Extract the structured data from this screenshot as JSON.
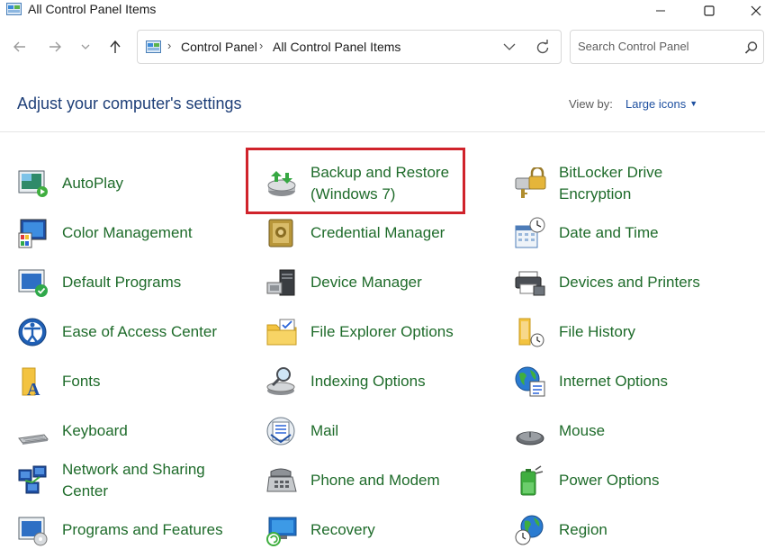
{
  "window": {
    "title": "All Control Panel Items",
    "controls": [
      "minimize",
      "maximize",
      "close"
    ]
  },
  "nav": {
    "breadcrumbs": [
      "Control Panel",
      "All Control Panel Items"
    ],
    "search_placeholder": "Search Control Panel"
  },
  "header": {
    "title": "Adjust your computer's settings",
    "view_by_label": "View by:",
    "view_by_value": "Large icons"
  },
  "selected_item": "Backup and Restore (Windows 7)",
  "items": [
    {
      "label": "AutoPlay",
      "icon": "autoplay-icon"
    },
    {
      "label": "Backup and Restore (Windows 7)",
      "icon": "backup-restore-icon"
    },
    {
      "label": "BitLocker Drive Encryption",
      "icon": "bitlocker-icon"
    },
    {
      "label": "Color Management",
      "icon": "color-management-icon"
    },
    {
      "label": "Credential Manager",
      "icon": "credential-manager-icon"
    },
    {
      "label": "Date and Time",
      "icon": "date-time-icon"
    },
    {
      "label": "Default Programs",
      "icon": "default-programs-icon"
    },
    {
      "label": "Device Manager",
      "icon": "device-manager-icon"
    },
    {
      "label": "Devices and Printers",
      "icon": "devices-printers-icon"
    },
    {
      "label": "Ease of Access Center",
      "icon": "ease-of-access-icon"
    },
    {
      "label": "File Explorer Options",
      "icon": "file-explorer-options-icon"
    },
    {
      "label": "File History",
      "icon": "file-history-icon"
    },
    {
      "label": "Fonts",
      "icon": "fonts-icon"
    },
    {
      "label": "Indexing Options",
      "icon": "indexing-options-icon"
    },
    {
      "label": "Internet Options",
      "icon": "internet-options-icon"
    },
    {
      "label": "Keyboard",
      "icon": "keyboard-icon"
    },
    {
      "label": "Mail",
      "icon": "mail-icon"
    },
    {
      "label": "Mouse",
      "icon": "mouse-icon"
    },
    {
      "label": "Network and Sharing Center",
      "icon": "network-sharing-icon"
    },
    {
      "label": "Phone and Modem",
      "icon": "phone-modem-icon"
    },
    {
      "label": "Power Options",
      "icon": "power-options-icon"
    },
    {
      "label": "Programs and Features",
      "icon": "programs-features-icon"
    },
    {
      "label": "Recovery",
      "icon": "recovery-icon"
    },
    {
      "label": "Region",
      "icon": "region-icon"
    }
  ],
  "colors": {
    "item_text": "#1e6b2a",
    "heading": "#1e3f78",
    "link": "#1e50a0",
    "highlight_border": "#d0232b"
  }
}
